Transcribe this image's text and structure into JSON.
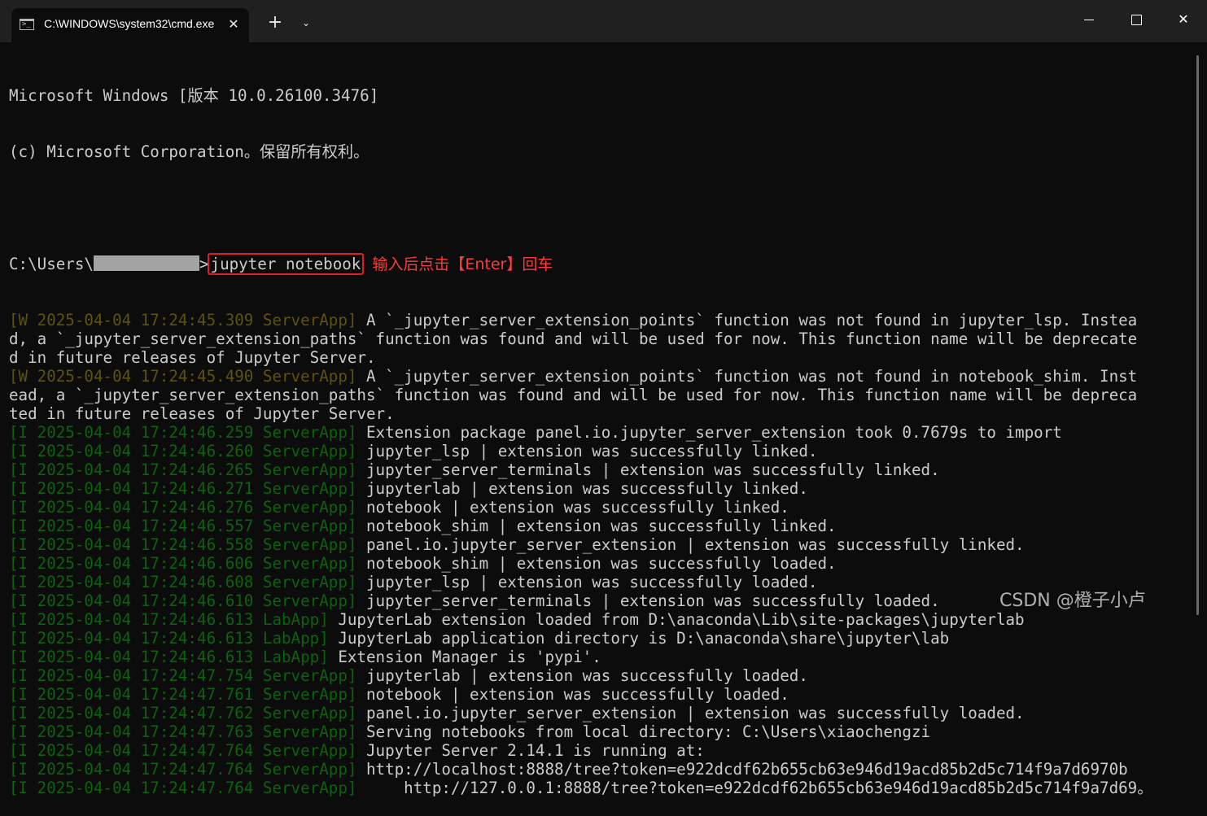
{
  "window": {
    "tab_title": "C:\\WINDOWS\\system32\\cmd.exe",
    "tab_icon": "console-icon",
    "close_glyph": "✕",
    "new_tab_glyph": "+",
    "menu_glyph": "⌄",
    "window_close_glyph": "✕"
  },
  "terminal": {
    "banner": [
      "Microsoft Windows [版本 10.0.26100.3476]",
      "(c) Microsoft Corporation。保留所有权利。"
    ],
    "prompt_prefix": "C:\\Users\\",
    "prompt_suffix": ">",
    "command": "jupyter notebook",
    "annotation": "输入后点击【Enter】回车",
    "log": [
      {
        "prefix": "[W 2025-04-04 17:24:45.309 ServerApp]",
        "level": "W",
        "text": " A `_jupyter_server_extension_points` function was not found in jupyter_lsp. Instea"
      },
      {
        "prefix": "",
        "level": "",
        "text": "d, a `_jupyter_server_extension_paths` function was found and will be used for now. This function name will be deprecate"
      },
      {
        "prefix": "",
        "level": "",
        "text": "d in future releases of Jupyter Server."
      },
      {
        "prefix": "[W 2025-04-04 17:24:45.490 ServerApp]",
        "level": "W",
        "text": " A `_jupyter_server_extension_points` function was not found in notebook_shim. Inst"
      },
      {
        "prefix": "",
        "level": "",
        "text": "ead, a `_jupyter_server_extension_paths` function was found and will be used for now. This function name will be depreca"
      },
      {
        "prefix": "",
        "level": "",
        "text": "ted in future releases of Jupyter Server."
      },
      {
        "prefix": "[I 2025-04-04 17:24:46.259 ServerApp]",
        "level": "I",
        "text": " Extension package panel.io.jupyter_server_extension took 0.7679s to import"
      },
      {
        "prefix": "[I 2025-04-04 17:24:46.260 ServerApp]",
        "level": "I",
        "text": " jupyter_lsp | extension was successfully linked."
      },
      {
        "prefix": "[I 2025-04-04 17:24:46.265 ServerApp]",
        "level": "I",
        "text": " jupyter_server_terminals | extension was successfully linked."
      },
      {
        "prefix": "[I 2025-04-04 17:24:46.271 ServerApp]",
        "level": "I",
        "text": " jupyterlab | extension was successfully linked."
      },
      {
        "prefix": "[I 2025-04-04 17:24:46.276 ServerApp]",
        "level": "I",
        "text": " notebook | extension was successfully linked."
      },
      {
        "prefix": "[I 2025-04-04 17:24:46.557 ServerApp]",
        "level": "I",
        "text": " notebook_shim | extension was successfully linked."
      },
      {
        "prefix": "[I 2025-04-04 17:24:46.558 ServerApp]",
        "level": "I",
        "text": " panel.io.jupyter_server_extension | extension was successfully linked."
      },
      {
        "prefix": "[I 2025-04-04 17:24:46.606 ServerApp]",
        "level": "I",
        "text": " notebook_shim | extension was successfully loaded."
      },
      {
        "prefix": "[I 2025-04-04 17:24:46.608 ServerApp]",
        "level": "I",
        "text": " jupyter_lsp | extension was successfully loaded."
      },
      {
        "prefix": "[I 2025-04-04 17:24:46.610 ServerApp]",
        "level": "I",
        "text": " jupyter_server_terminals | extension was successfully loaded."
      },
      {
        "prefix": "[I 2025-04-04 17:24:46.613 LabApp]",
        "level": "I",
        "text": " JupyterLab extension loaded from D:\\anaconda\\Lib\\site-packages\\jupyterlab"
      },
      {
        "prefix": "[I 2025-04-04 17:24:46.613 LabApp]",
        "level": "I",
        "text": " JupyterLab application directory is D:\\anaconda\\share\\jupyter\\lab"
      },
      {
        "prefix": "[I 2025-04-04 17:24:46.613 LabApp]",
        "level": "I",
        "text": " Extension Manager is 'pypi'."
      },
      {
        "prefix": "[I 2025-04-04 17:24:47.754 ServerApp]",
        "level": "I",
        "text": " jupyterlab | extension was successfully loaded."
      },
      {
        "prefix": "[I 2025-04-04 17:24:47.761 ServerApp]",
        "level": "I",
        "text": " notebook | extension was successfully loaded."
      },
      {
        "prefix": "[I 2025-04-04 17:24:47.762 ServerApp]",
        "level": "I",
        "text": " panel.io.jupyter_server_extension | extension was successfully loaded."
      },
      {
        "prefix": "[I 2025-04-04 17:24:47.763 ServerApp]",
        "level": "I",
        "text": " Serving notebooks from local directory: C:\\Users\\xiaochengzi"
      },
      {
        "prefix": "[I 2025-04-04 17:24:47.764 ServerApp]",
        "level": "I",
        "text": " Jupyter Server 2.14.1 is running at:"
      },
      {
        "prefix": "[I 2025-04-04 17:24:47.764 ServerApp]",
        "level": "I",
        "text": " http://localhost:8888/tree?token=e922dcdf62b655cb63e946d19acd85b2d5c714f9a7d6970b"
      },
      {
        "prefix": "[I 2025-04-04 17:24:47.764 ServerApp]",
        "level": "I",
        "text": "     http://127.0.0.1:8888/tree?token=e922dcdf62b655cb63e946d19acd85b2d5c714f9a7d69。"
      }
    ]
  },
  "watermark": "CSDN @橙子小卢",
  "colors": {
    "background": "#0c0c0c",
    "text": "#cccccc",
    "warn_prefix": "#5e520f",
    "info_prefix": "#0d620d",
    "annotation": "#ff3a3a"
  }
}
